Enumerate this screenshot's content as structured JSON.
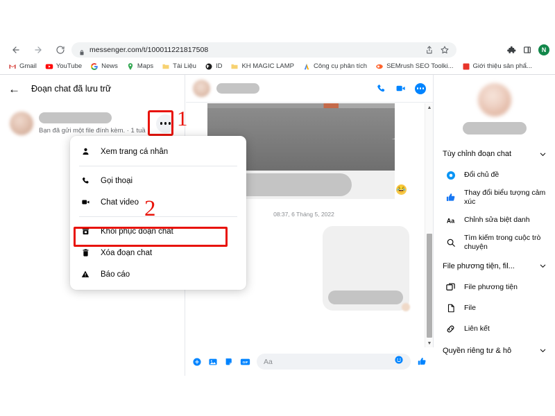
{
  "browser": {
    "nav": {
      "back": "←",
      "forward": "→",
      "reload": "⟳",
      "home": "⌂"
    },
    "omnibox": {
      "url": "messenger.com/t/100011221817508",
      "lock_icon": "lock-icon",
      "share_icon": "share-icon",
      "star_icon": "bookmark-star-icon"
    },
    "toolbar_right": {
      "extensions_icon": "extensions-puzzle-icon",
      "sidepanel_icon": "side-panel-icon",
      "profile_initial": "N"
    },
    "bookmarks": [
      {
        "label": "Gmail",
        "icon": "gmail-icon"
      },
      {
        "label": "YouTube",
        "icon": "youtube-icon"
      },
      {
        "label": "News",
        "icon": "google-news-icon"
      },
      {
        "label": "Maps",
        "icon": "google-maps-icon"
      },
      {
        "label": "Tài Liệu",
        "icon": "folder-icon"
      },
      {
        "label": "ID",
        "icon": "globe-icon"
      },
      {
        "label": "KH MAGIC LAMP",
        "icon": "folder-icon"
      },
      {
        "label": "Công cụ phân tích",
        "icon": "analytics-icon"
      },
      {
        "label": "SEMrush SEO Toolki...",
        "icon": "semrush-icon"
      },
      {
        "label": "Giới thiệu sản phẩ...",
        "icon": "red-square-icon"
      }
    ]
  },
  "left_panel": {
    "back_icon": "back-arrow-icon",
    "title": "Đoạn chat đã lưu trữ",
    "conversation": {
      "avatar": "blurred-avatar",
      "name_redacted": "",
      "snippet": "Bạn đã gửi một file đính kèm. · 1 tuầ",
      "more_icon": "more-options-icon"
    }
  },
  "annotations": {
    "step1": "1",
    "step2": "2",
    "highlight_color": "#e81309"
  },
  "context_menu": {
    "items": [
      {
        "label": "Xem trang cá nhân",
        "icon": "person-icon",
        "divider_after": true
      },
      {
        "label": "Gọi thoại",
        "icon": "phone-icon",
        "divider_after": false
      },
      {
        "label": "Chat video",
        "icon": "video-camera-icon",
        "divider_after": true
      },
      {
        "label": "Khôi phục đoạn chat",
        "icon": "unarchive-icon",
        "divider_after": false
      },
      {
        "label": "Xóa đoạn chat",
        "icon": "trash-icon",
        "divider_after": false
      },
      {
        "label": "Báo cáo",
        "icon": "warning-triangle-icon",
        "divider_after": false
      }
    ],
    "highlighted_index": 3
  },
  "chat": {
    "header": {
      "avatar": "blurred-avatar",
      "name_redacted": "",
      "call_icon": "phone-call-icon",
      "video_icon": "video-call-icon",
      "info_icon": "conversation-info-icon"
    },
    "timestamp": "08:37, 6 Tháng 5, 2022",
    "reaction_emoji": "😂",
    "composer": {
      "add_icon": "plus-circle-icon",
      "photo_icon": "image-icon",
      "sticker_icon": "sticker-icon",
      "gif_icon": "gif-icon",
      "placeholder": "Aa",
      "emoji_icon": "emoji-smiley-icon",
      "like_icon": "thumbs-up-icon"
    },
    "scrollbar": {
      "up": "▲",
      "down": "▼"
    }
  },
  "right_panel": {
    "profile": {
      "avatar": "blurred-avatar",
      "name_redacted": ""
    },
    "sections": [
      {
        "title": "Tùy chỉnh đoạn chat",
        "chevron": "chevron-down-icon",
        "items": [
          {
            "label": "Đổi chủ đề",
            "icon": "color-circle-icon"
          },
          {
            "label": "Thay đổi biểu tượng cảm xúc",
            "icon": "thumbs-up-icon"
          },
          {
            "label": "Chỉnh sửa biệt danh",
            "icon": "aa-text-icon"
          },
          {
            "label": "Tìm kiếm trong cuộc trò chuyện",
            "icon": "search-icon"
          }
        ]
      },
      {
        "title": "File phương tiện, fil...",
        "chevron": "chevron-down-icon",
        "items": [
          {
            "label": "File phương tiện",
            "icon": "media-photos-icon"
          },
          {
            "label": "File",
            "icon": "file-document-icon"
          },
          {
            "label": "Liên kết",
            "icon": "link-chain-icon"
          }
        ]
      },
      {
        "title": "Quyền riêng tư & hỗ",
        "chevron": "chevron-down-icon",
        "items": []
      }
    ]
  }
}
